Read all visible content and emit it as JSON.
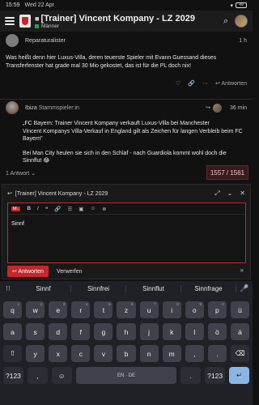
{
  "status_bar": {
    "time": "15:59",
    "date": "Wed 22 Apr",
    "battery": "49"
  },
  "header": {
    "title": "[Trainer] Vincent Kompany - LZ 2029",
    "category": "Männer"
  },
  "posts": [
    {
      "user": "Reparaturalister",
      "time": "1 h",
      "text": "Was heißt denn hier Luxus-Villa, deren teuerste Spieler mit Evann Guessand dieses Transferfenster hat grade mal 30 Mio gekostet, das ist für die PL doch nix!",
      "reply_label": "Antworten"
    },
    {
      "user": "Ibiza",
      "user_tag": "Stammspieler:in",
      "time": "36 min",
      "paragraphs": [
        "„FC Bayern: Trainer Vincent Kompany verkauft Luxus-Villa bei Manchester",
        "Vincent Kompanys Villa-Verkauf in England gilt als Zeichen für langen Verbleib beim FC Bayern\"",
        "Bei Man City heulen sie sich in den Schlaf - nach Guardiola kommt wohl doch die Sinnflut 😂"
      ],
      "replies_label": "1 Antwort",
      "like_count": "1",
      "reply_label": "Antworten"
    }
  ],
  "progress": "1557 / 1561",
  "composer": {
    "title": "[Trainer] Vincent Kompany - LZ 2029",
    "text": "Sinnf",
    "submit_label": "Antworten",
    "discard_label": "Verwerfen"
  },
  "keyboard": {
    "suggestions": [
      "Sinnf",
      "Sinnfrei",
      "Sinnflut",
      "Sinnfrage"
    ],
    "row1": [
      "q",
      "w",
      "e",
      "r",
      "t",
      "z",
      "u",
      "i",
      "o",
      "p",
      "ü"
    ],
    "row1_sup": [
      "1",
      "2",
      "3",
      "4",
      "5",
      "6",
      "7",
      "8",
      "9",
      "0",
      ""
    ],
    "row2": [
      "a",
      "s",
      "d",
      "f",
      "g",
      "h",
      "j",
      "k",
      "l",
      "ö",
      "ä"
    ],
    "row3": [
      "⇧",
      "y",
      "x",
      "c",
      "v",
      "b",
      "n",
      "m",
      ",",
      ".",
      "⌫"
    ],
    "row4_left": "?123",
    "space_label": "EN · DE",
    "row4_right": "?123"
  }
}
